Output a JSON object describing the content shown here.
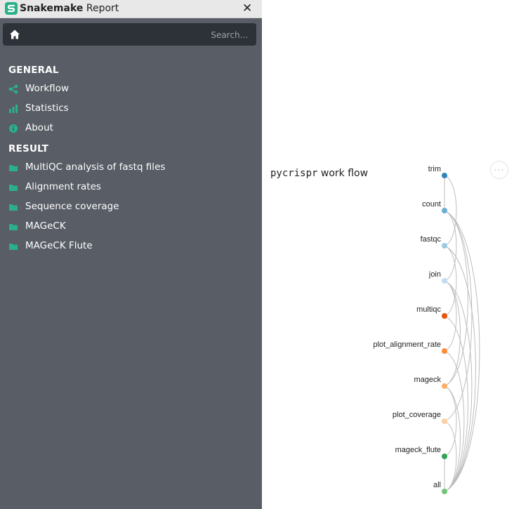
{
  "titlebar": {
    "brand_bold": "Snakemake",
    "brand_light": "Report",
    "close_symbol": "✕"
  },
  "search": {
    "placeholder": "Search..."
  },
  "sidebar": {
    "accent_color": "#2bb08a",
    "sections": [
      {
        "heading": "GENERAL",
        "items": [
          {
            "label": "Workflow",
            "icon": "share-icon"
          },
          {
            "label": "Statistics",
            "icon": "bar-chart-icon"
          },
          {
            "label": "About",
            "icon": "info-icon"
          }
        ]
      },
      {
        "heading": "RESULT",
        "items": [
          {
            "label": "MultiQC analysis of fastq files",
            "icon": "folder-icon"
          },
          {
            "label": "Alignment rates",
            "icon": "folder-icon"
          },
          {
            "label": "Sequence coverage",
            "icon": "folder-icon"
          },
          {
            "label": "MAGeCK",
            "icon": "folder-icon"
          },
          {
            "label": "MAGeCK Flute",
            "icon": "folder-icon"
          }
        ]
      }
    ]
  },
  "main": {
    "title_mono": "pycrispr",
    "title_rest": "work flow",
    "more_symbol": "···"
  },
  "workflow": {
    "nodes": [
      {
        "name": "trim",
        "color": "#3182bd"
      },
      {
        "name": "count",
        "color": "#6baed6"
      },
      {
        "name": "fastqc",
        "color": "#9ecae1"
      },
      {
        "name": "join",
        "color": "#c6dbef"
      },
      {
        "name": "multiqc",
        "color": "#e6550d"
      },
      {
        "name": "plot_alignment_rate",
        "color": "#fd8d3c"
      },
      {
        "name": "mageck",
        "color": "#fdae6b"
      },
      {
        "name": "plot_coverage",
        "color": "#fdd0a2"
      },
      {
        "name": "mageck_flute",
        "color": "#31a354"
      },
      {
        "name": "all",
        "color": "#74c476"
      }
    ],
    "edges": [
      [
        "trim",
        "count"
      ],
      [
        "trim",
        "fastqc"
      ],
      [
        "count",
        "join"
      ],
      [
        "count",
        "mageck"
      ],
      [
        "count",
        "plot_coverage"
      ],
      [
        "count",
        "all"
      ],
      [
        "fastqc",
        "multiqc"
      ],
      [
        "fastqc",
        "all"
      ],
      [
        "join",
        "plot_alignment_rate"
      ],
      [
        "join",
        "mageck"
      ],
      [
        "join",
        "all"
      ],
      [
        "multiqc",
        "all"
      ],
      [
        "plot_alignment_rate",
        "all"
      ],
      [
        "mageck",
        "mageck_flute"
      ],
      [
        "mageck",
        "all"
      ],
      [
        "plot_coverage",
        "all"
      ],
      [
        "mageck_flute",
        "all"
      ]
    ]
  }
}
